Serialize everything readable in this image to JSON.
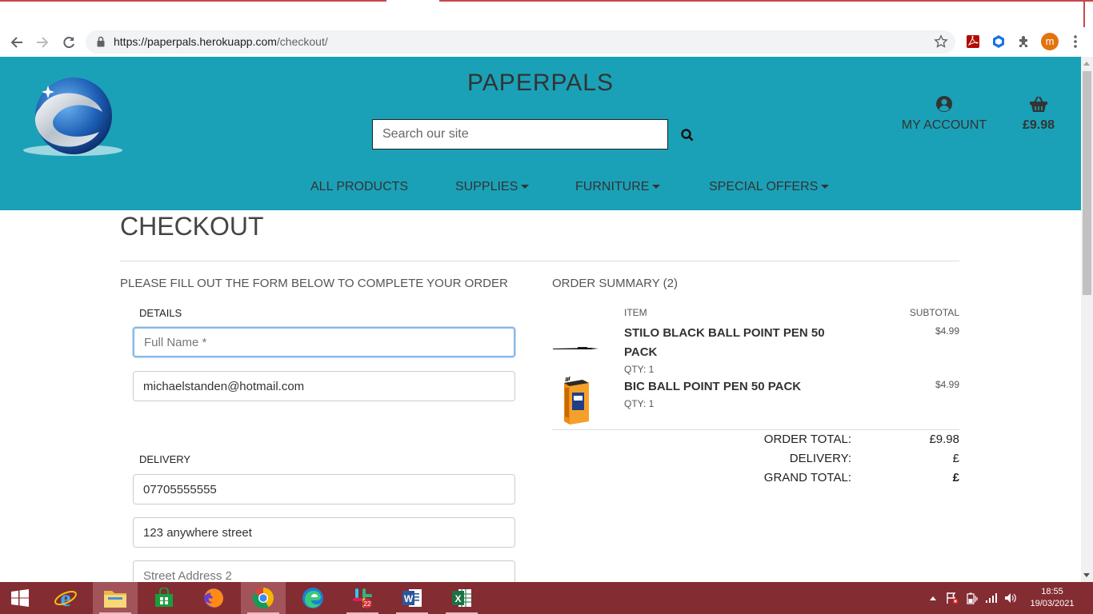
{
  "browser": {
    "url_host": "https://paperpals.herokuapp.com",
    "url_path": "/checkout/",
    "avatar_letter": "m"
  },
  "header": {
    "brand": "PAPERPALS",
    "search_placeholder": "Search our site",
    "account_label": "MY ACCOUNT",
    "basket_total": "£9.98",
    "bg_color": "#1aa1b7"
  },
  "nav": {
    "all_products": "ALL PRODUCTS",
    "supplies": "SUPPLIES",
    "furniture": "FURNITURE",
    "special_offers": "SPECIAL OFFERS"
  },
  "checkout": {
    "title": "CHECKOUT",
    "lead": "PLEASE FILL OUT THE FORM BELOW TO COMPLETE YOUR ORDER",
    "details_legend": "DETAILS",
    "full_name_placeholder": "Full Name *",
    "email_value": "michaelstanden@hotmail.com",
    "delivery_legend": "DELIVERY",
    "phone_value": "07705555555",
    "street1_value": "123 anywhere street",
    "street2_placeholder": "Street Address 2"
  },
  "summary": {
    "title": "ORDER SUMMARY (2)",
    "col_item": "ITEM",
    "col_subtotal": "SUBTOTAL",
    "items": [
      {
        "name": "STILO BLACK BALL POINT PEN 50 PACK",
        "qty": "QTY: 1",
        "price": "$4.99"
      },
      {
        "name": "BIC BALL POINT PEN 50 PACK",
        "qty": "QTY: 1",
        "price": "$4.99"
      }
    ],
    "order_total_label": "ORDER TOTAL:",
    "order_total_value": "£9.98",
    "delivery_label": "DELIVERY:",
    "delivery_value": "£",
    "grand_total_label": "GRAND TOTAL:",
    "grand_total_value": "£"
  },
  "taskbar": {
    "time": "18:55",
    "date": "19/03/2021",
    "slack_badge": "22"
  }
}
